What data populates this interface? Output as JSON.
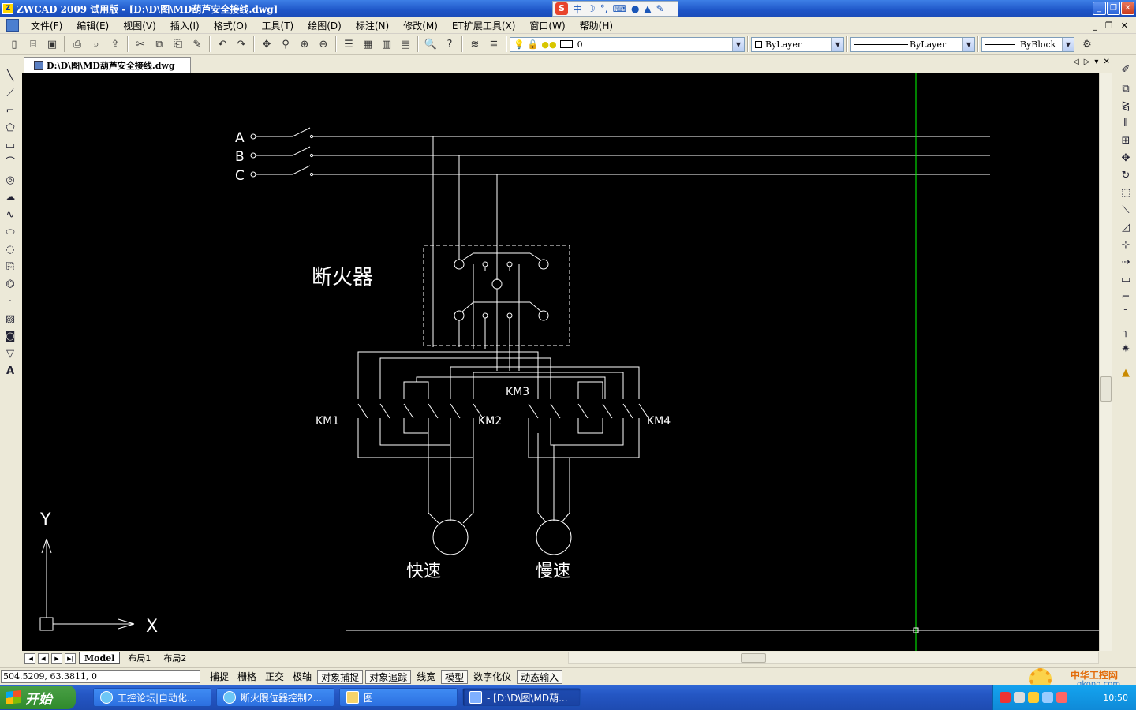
{
  "window": {
    "title": "ZWCAD 2009 试用版 - [D:\\D\\图\\MD葫芦安全接线.dwg]",
    "app_icon": "zwcad-logo-icon",
    "ime": {
      "logo": "S",
      "lang": "中",
      "moon": "☽",
      "punct": "°,",
      "kbd": "⌨"
    },
    "controls": {
      "minimize": "_",
      "restore": "❐",
      "close": "✕"
    }
  },
  "menu": {
    "items": [
      "文件(F)",
      "编辑(E)",
      "视图(V)",
      "插入(I)",
      "格式(O)",
      "工具(T)",
      "绘图(D)",
      "标注(N)",
      "修改(M)",
      "ET扩展工具(X)",
      "窗口(W)",
      "帮助(H)"
    ],
    "mdi_controls": {
      "minimize": "_",
      "restore": "❐",
      "close": "✕"
    }
  },
  "toolbar": {
    "layer_value": "0",
    "color_value": "ByLayer",
    "linetype_value": "ByLayer",
    "lineweight_value": "ByBlock"
  },
  "document_tab": {
    "label": "D:\\D\\图\\MD葫芦安全接线.dwg",
    "nav": {
      "prev": "◁",
      "next": "▷",
      "menu": "▾",
      "close": "✕"
    }
  },
  "drawing": {
    "phases": [
      "A",
      "B",
      "C"
    ],
    "breaker_label": "断火器",
    "contactors": [
      "KM1",
      "KM2",
      "KM3",
      "KM4"
    ],
    "motors": [
      "快速",
      "慢速"
    ],
    "ucs": {
      "x_label": "X",
      "y_label": "Y"
    },
    "colors": {
      "background": "#000000",
      "lines": "#ffffff",
      "cursor": "#00ff00"
    }
  },
  "layout_tabs": {
    "tabs": [
      "Model",
      "布局1",
      "布局2"
    ],
    "active": "Model"
  },
  "statusbar": {
    "coordinates": "504.5209, 63.3811, 0",
    "toggles": [
      {
        "label": "捕捉",
        "on": false
      },
      {
        "label": "栅格",
        "on": false
      },
      {
        "label": "正交",
        "on": false
      },
      {
        "label": "极轴",
        "on": false
      },
      {
        "label": "对象捕捉",
        "on": true
      },
      {
        "label": "对象追踪",
        "on": true
      },
      {
        "label": "线宽",
        "on": false
      },
      {
        "label": "模型",
        "on": true
      },
      {
        "label": "数字化仪",
        "on": false
      },
      {
        "label": "动态输入",
        "on": true
      }
    ]
  },
  "taskbar": {
    "start_label": "开始",
    "tasks": [
      {
        "label": "工控论坛|自动化...",
        "active": false
      },
      {
        "label": "断火限位器控制2...",
        "active": false
      },
      {
        "label": "图",
        "active": false
      },
      {
        "label": "- [D:\\D\\图\\MD葫...",
        "active": true
      }
    ],
    "clock": "10:50"
  },
  "watermark": {
    "title": "中华工控网",
    "url": "gkong.com"
  }
}
